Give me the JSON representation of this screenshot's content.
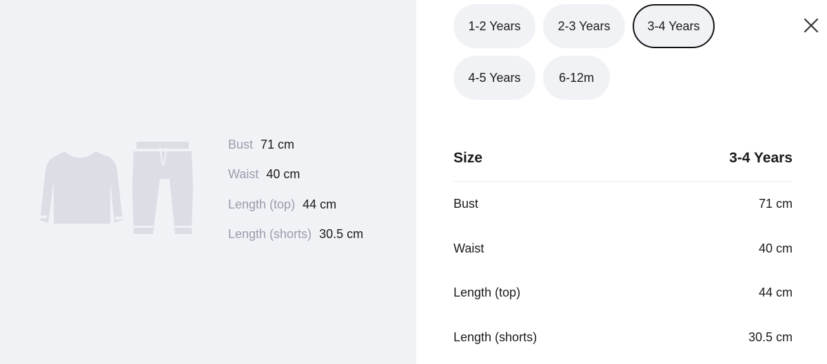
{
  "illustration": {
    "icons": [
      "sweatshirt-icon",
      "jogger-pants-icon"
    ],
    "color": "#dcdde5"
  },
  "summary": [
    {
      "label": "Bust",
      "value": "71 cm"
    },
    {
      "label": "Waist",
      "value": "40 cm"
    },
    {
      "label": "Length (top)",
      "value": "44 cm"
    },
    {
      "label": "Length (shorts)",
      "value": "30.5 cm"
    }
  ],
  "size_options": [
    {
      "label": "1-2 Years",
      "selected": false
    },
    {
      "label": "2-3 Years",
      "selected": false
    },
    {
      "label": "3-4 Years",
      "selected": true
    },
    {
      "label": "4-5 Years",
      "selected": false
    },
    {
      "label": "6-12m",
      "selected": false
    }
  ],
  "close_icon": "close-icon",
  "table": {
    "header_label": "Size",
    "header_value": "3-4 Years",
    "rows": [
      {
        "label": "Bust",
        "value": "71 cm"
      },
      {
        "label": "Waist",
        "value": "40 cm"
      },
      {
        "label": "Length (top)",
        "value": "44 cm"
      },
      {
        "label": "Length (shorts)",
        "value": "30.5 cm"
      }
    ]
  },
  "colors": {
    "panel_background": "#f1f2f6",
    "pill_background": "#f1f2f6",
    "selected_border": "#111111",
    "muted_text": "#9a9cab"
  }
}
